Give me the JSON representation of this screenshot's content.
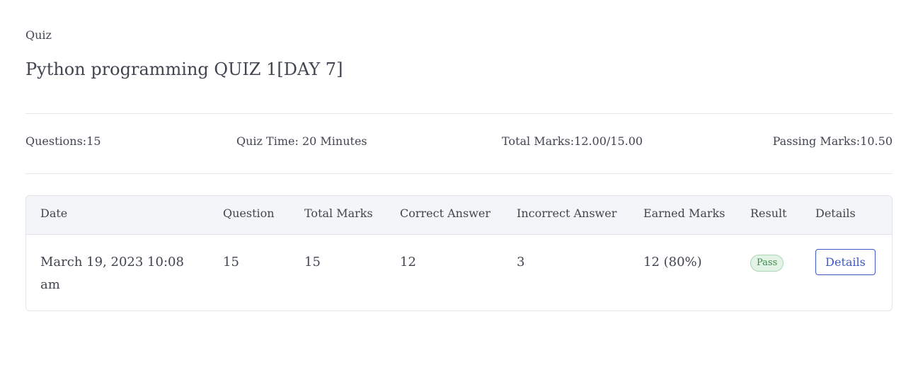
{
  "header": {
    "kicker": "Quiz",
    "title": "Python programming QUIZ 1[DAY 7]"
  },
  "meta": {
    "questions": "Questions:15",
    "quiz_time": "Quiz Time: 20 Minutes",
    "total_marks": "Total Marks:12.00/15.00",
    "passing_marks": "Passing Marks:10.50"
  },
  "table": {
    "columns": [
      "Date",
      "Question",
      "Total Marks",
      "Correct Answer",
      "Incorrect Answer",
      "Earned Marks",
      "Result",
      "Details"
    ],
    "rows": [
      {
        "date": "March 19, 2023 10:08 am",
        "question": "15",
        "total_marks": "15",
        "correct_answer": "12",
        "incorrect_answer": "3",
        "earned_marks": "12 (80%)",
        "result": "Pass",
        "details_label": "Details"
      }
    ]
  },
  "colors": {
    "text": "#41454f",
    "header_bg": "#f4f5f8",
    "border": "#e3e5eb",
    "pass_text": "#3f8a4f",
    "pass_bg": "#e3f3e6",
    "accent": "#3e59c1"
  }
}
